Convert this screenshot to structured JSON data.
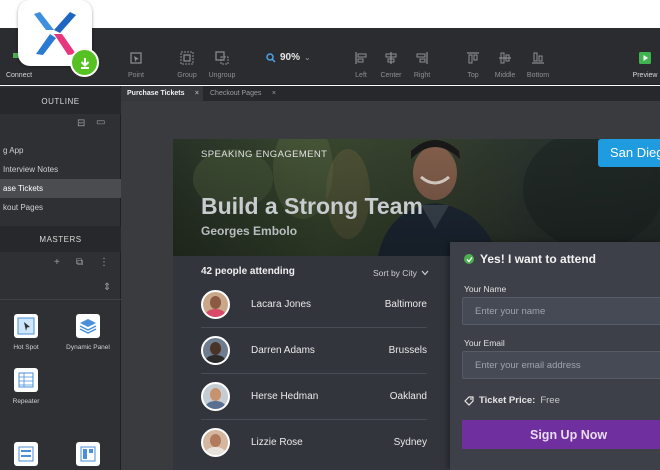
{
  "toolbar": {
    "connect_label": "Connect",
    "point_label": "Point",
    "group_label": "Group",
    "ungroup_label": "Ungroup",
    "zoom_value": "90%",
    "left_label": "Left",
    "center_label": "Center",
    "right_label": "Right",
    "top_label": "Top",
    "middle_label": "Middle",
    "bottom_label": "Bottom",
    "preview_label": "Preview"
  },
  "outline": {
    "header": "OUTLINE",
    "items": [
      {
        "label": "g App"
      },
      {
        "label": "Interview Notes"
      },
      {
        "label": "ase Tickets"
      },
      {
        "label": "kout Pages"
      }
    ]
  },
  "masters": {
    "header": "MASTERS",
    "widgets": [
      {
        "label": "Hot Spot"
      },
      {
        "label": "Dynamic Panel"
      },
      {
        "label": "Repeater"
      }
    ]
  },
  "tabs": [
    {
      "label": "Purchase Tickets"
    },
    {
      "label": "Checkout Pages"
    }
  ],
  "hero": {
    "eyebrow": "SPEAKING ENGAGEMENT",
    "title": "Build a Strong Team",
    "speaker": "Georges Embolo",
    "city_badge": "San Diego"
  },
  "attendees": {
    "count_label": "42 people attending",
    "sort_label": "Sort by City",
    "rows": [
      {
        "name": "Lacara Jones",
        "city": "Baltimore"
      },
      {
        "name": "Darren Adams",
        "city": "Brussels"
      },
      {
        "name": "Herse Hedman",
        "city": "Oakland"
      },
      {
        "name": "Lizzie Rose",
        "city": "Sydney"
      }
    ]
  },
  "form": {
    "title": "Yes! I want to attend",
    "name_label": "Your Name",
    "name_placeholder": "Enter your name",
    "email_label": "Your Email",
    "email_placeholder": "Enter your email address",
    "price_label": "Ticket Price:",
    "price_value": "Free",
    "signup_label": "Sign Up Now"
  },
  "colors": {
    "toolbar_bg": "#2b2c2f",
    "panel_bg": "#2f3033",
    "canvas_bg": "#3a3b3f",
    "accent_blue": "#1f9ce0",
    "signup_purple": "#6f2f9e",
    "check_green": "#4caf50",
    "logo_badge_green": "#55c122"
  },
  "icons": [
    "connect-icon",
    "point-icon",
    "group-icon",
    "ungroup-icon",
    "zoom-search-icon",
    "align-left-icon",
    "align-center-icon",
    "align-right-icon",
    "align-top-icon",
    "align-middle-icon",
    "align-bottom-icon",
    "preview-play-icon",
    "download-icon",
    "app-logo-x-icon",
    "check-circle-icon",
    "ticket-icon",
    "chevron-down-icon"
  ]
}
